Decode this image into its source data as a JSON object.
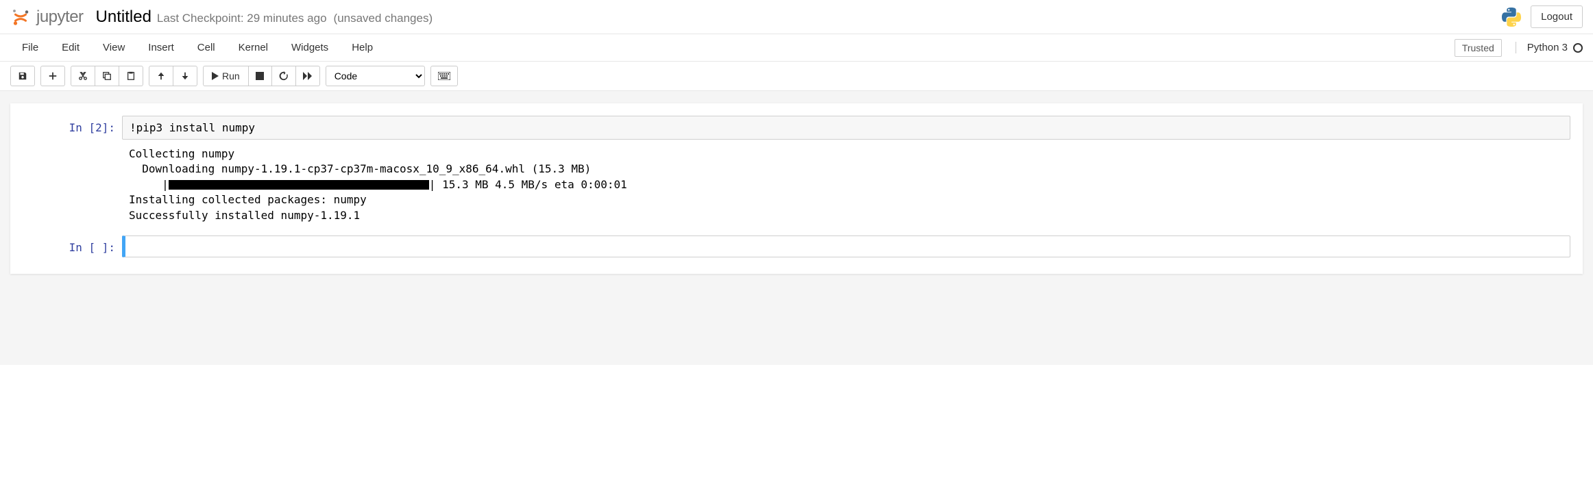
{
  "header": {
    "logo_text": "jupyter",
    "title": "Untitled",
    "checkpoint_text": "Last Checkpoint: 29 minutes ago",
    "unsaved_text": "(unsaved changes)",
    "logout_label": "Logout"
  },
  "menubar": {
    "items": [
      "File",
      "Edit",
      "View",
      "Insert",
      "Cell",
      "Kernel",
      "Widgets",
      "Help"
    ],
    "trusted_label": "Trusted",
    "kernel_name": "Python 3"
  },
  "toolbar": {
    "run_label": "Run",
    "cell_type_selected": "Code"
  },
  "cells": [
    {
      "prompt": "In [2]:",
      "code": "!pip3 install numpy",
      "output_lines": [
        "Collecting numpy",
        "  Downloading numpy-1.19.1-cp37-cp37m-macosx_10_9_x86_64.whl (15.3 MB)",
        "",
        "Installing collected packages: numpy",
        "Successfully installed numpy-1.19.1"
      ],
      "progress_prefix": "     |",
      "progress_suffix": "| 15.3 MB 4.5 MB/s eta 0:00:01"
    },
    {
      "prompt": "In [ ]:",
      "code": "",
      "selected": true
    }
  ]
}
